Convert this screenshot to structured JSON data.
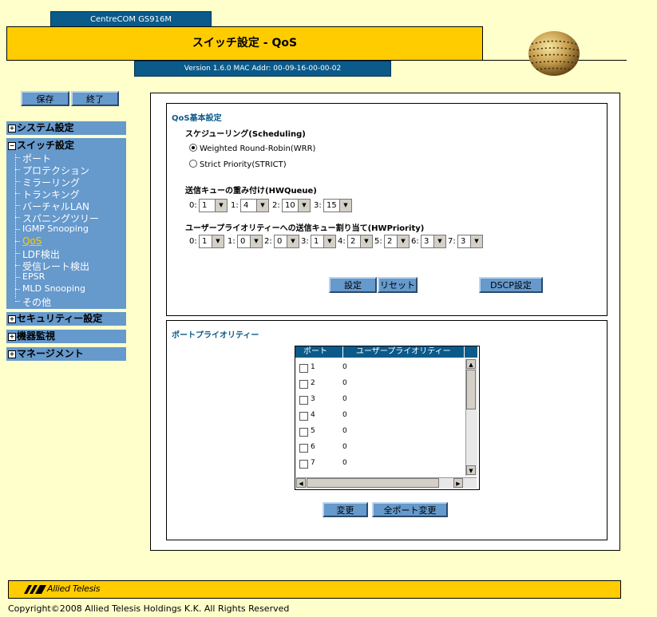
{
  "header": {
    "model": "CentreCOM GS916M",
    "title": "スイッチ設定 - QoS",
    "version": "Version 1.6.0 MAC Addr: 00-09-16-00-00-02"
  },
  "top_buttons": {
    "save": "保存",
    "exit": "終了"
  },
  "sidebar": {
    "system": "システム設定",
    "switch": "スイッチ設定",
    "switch_items": [
      "ポート",
      "プロテクション",
      "ミラーリング",
      "トランキング",
      "バーチャルLAN",
      "スパニングツリー",
      "IGMP Snooping",
      "QoS",
      "LDF検出",
      "受信レート検出",
      "EPSR",
      "MLD Snooping",
      "その他"
    ],
    "active_item": "QoS",
    "security": "セキュリティー設定",
    "monitor": "機器監視",
    "management": "マネージメント"
  },
  "qos": {
    "title": "QoS基本設定",
    "scheduling_label": "スケジューリング(Scheduling)",
    "option_wrr": "Weighted Round-Robin(WRR)",
    "option_strict": "Strict Priority(STRICT)",
    "selected_option": "wrr",
    "hwqueue_label": "送信キューの重み付け(HWQueue)",
    "hwqueue": [
      {
        "index": "0:",
        "value": "1"
      },
      {
        "index": "1:",
        "value": "4"
      },
      {
        "index": "2:",
        "value": "10"
      },
      {
        "index": "3:",
        "value": "15"
      }
    ],
    "hwpriority_label": "ユーザープライオリティーへの送信キュー割り当て(HWPriority)",
    "hwpriority": [
      {
        "index": "0:",
        "value": "1"
      },
      {
        "index": "1:",
        "value": "0"
      },
      {
        "index": "2:",
        "value": "0"
      },
      {
        "index": "3:",
        "value": "1"
      },
      {
        "index": "4:",
        "value": "2"
      },
      {
        "index": "5:",
        "value": "2"
      },
      {
        "index": "6:",
        "value": "3"
      },
      {
        "index": "7:",
        "value": "3"
      }
    ],
    "set_button": "設定",
    "reset_button": "リセット",
    "dscp_button": "DSCP設定"
  },
  "port_priority": {
    "title": "ポートプライオリティー",
    "col_port": "ポート",
    "col_priority": "ユーザープライオリティー",
    "rows": [
      {
        "port": "1",
        "priority": "0"
      },
      {
        "port": "2",
        "priority": "0"
      },
      {
        "port": "3",
        "priority": "0"
      },
      {
        "port": "4",
        "priority": "0"
      },
      {
        "port": "5",
        "priority": "0"
      },
      {
        "port": "6",
        "priority": "0"
      },
      {
        "port": "7",
        "priority": "0"
      }
    ],
    "change_button": "変更",
    "change_all_button": "全ポート変更"
  },
  "footer": {
    "brand": "Allied Telesis",
    "copyright": "Copyright©2008 Allied Telesis Holdings K.K. All Rights Reserved"
  },
  "colors": {
    "brand_blue": "#0a5a8a",
    "menu_blue": "#6699cc",
    "accent_yellow": "#ffcc00",
    "background": "#ffffcc"
  }
}
